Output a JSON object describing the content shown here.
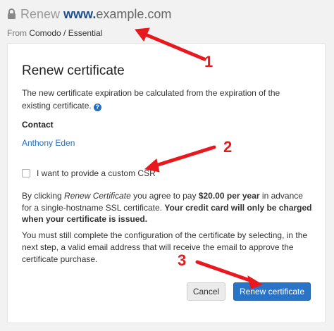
{
  "header": {
    "title_prefix": "Renew ",
    "domain_www": "www.",
    "domain_rest": "example.com",
    "from_label": "From",
    "provider": "Comodo / Essential"
  },
  "card": {
    "title": "Renew certificate",
    "description": "The new certificate expiration be calculated from the expiration of the existing certificate.",
    "help_icon_glyph": "?",
    "contact_label": "Contact",
    "contact_name": "Anthony Eden",
    "csr_checkbox_label": "I want to provide a custom CSR",
    "csr_checked": false,
    "pay_text_1": "By clicking ",
    "pay_text_italic": "Renew Certificate",
    "pay_text_2": " you agree to pay ",
    "pay_amount": "$20.00 per year",
    "pay_text_3": " in advance for a single-hostname SSL certificate. ",
    "pay_bold_notice": "Your credit card will only be charged when your certificate is issued.",
    "config_text": "You must still complete the configuration of the certificate by selecting, in the next step, a valid email address that will receive the email to approve the certificate purchase.",
    "cancel_label": "Cancel",
    "renew_label": "Renew certificate"
  },
  "annotations": {
    "marker_1": "1",
    "marker_2": "2",
    "marker_3": "3",
    "color": "#e8191e"
  },
  "icons": {
    "lock": "lock-icon",
    "help": "help-icon"
  }
}
